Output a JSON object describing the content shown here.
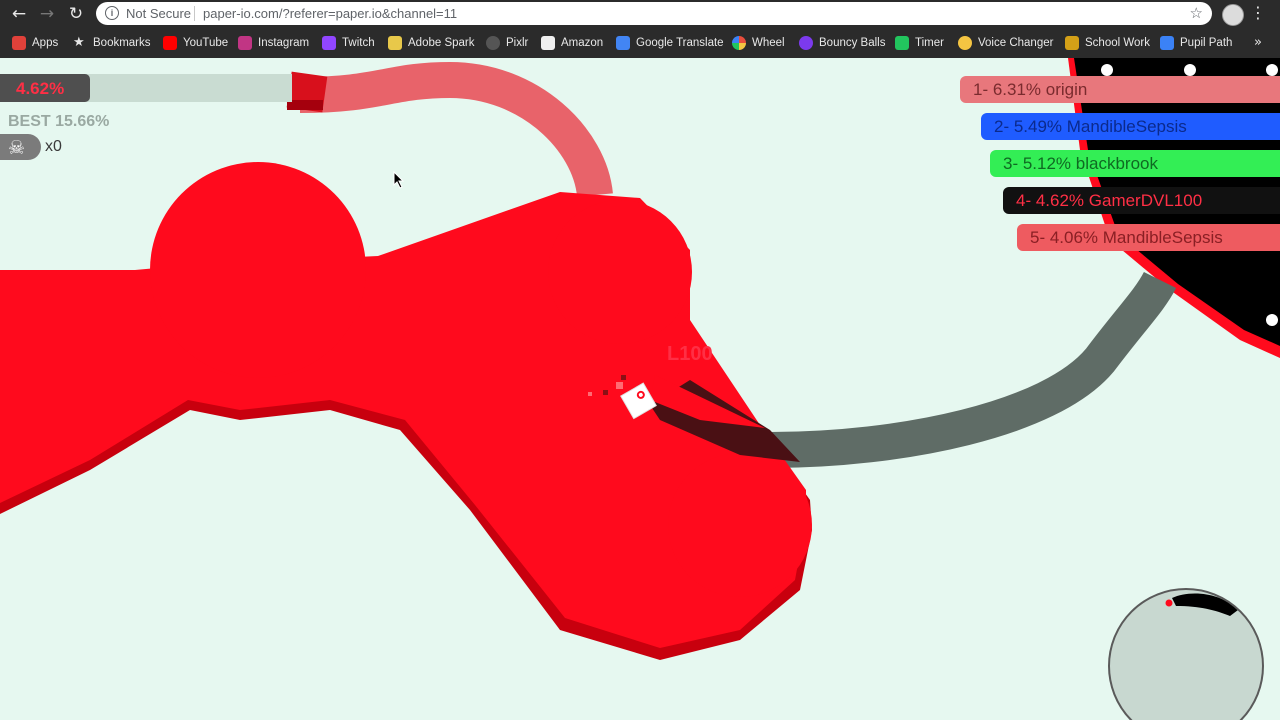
{
  "browser": {
    "security_label": "Not Secure",
    "url": "paper-io.com/?referer=paper.io&channel=11",
    "bookmarks": [
      {
        "label": "Apps",
        "icon": "apps-grid-icon",
        "color": "#e0413a"
      },
      {
        "label": "Bookmarks",
        "icon": "star-icon",
        "color": "#e8e8e8"
      },
      {
        "label": "YouTube",
        "icon": "youtube-icon",
        "color": "#ff0000"
      },
      {
        "label": "Instagram",
        "icon": "instagram-icon",
        "color": "#c13584"
      },
      {
        "label": "Twitch",
        "icon": "twitch-icon",
        "color": "#9146ff"
      },
      {
        "label": "Adobe Spark",
        "icon": "adobe-spark-icon",
        "color": "#e8c84a"
      },
      {
        "label": "Pixlr",
        "icon": "pixlr-icon",
        "color": "#555555"
      },
      {
        "label": "Amazon",
        "icon": "amazon-icon",
        "color": "#f0f0f0"
      },
      {
        "label": "Google Translate",
        "icon": "google-translate-icon",
        "color": "#4285f4"
      },
      {
        "label": "Wheel",
        "icon": "wheel-icon",
        "color": "#e94d3c"
      },
      {
        "label": "Bouncy Balls",
        "icon": "bouncy-balls-icon",
        "color": "#7c3aed"
      },
      {
        "label": "Timer",
        "icon": "timer-icon",
        "color": "#22c55e"
      },
      {
        "label": "Voice Changer",
        "icon": "voice-changer-icon",
        "color": "#f5c542"
      },
      {
        "label": "School Work",
        "icon": "school-work-icon",
        "color": "#d4a017"
      },
      {
        "label": "Pupil Path",
        "icon": "pupil-path-icon",
        "color": "#3b82f6"
      }
    ],
    "more_label": "»"
  },
  "hud": {
    "score": "4.62%",
    "best": "BEST 15.66%",
    "kills": "x0",
    "player_name_visible": "L100"
  },
  "leaderboard": [
    {
      "text": "1- 6.31% origin",
      "bg": "#e8777c",
      "fg": "#7a2b2e"
    },
    {
      "text": "2- 5.49% MandibleSepsis",
      "bg": "#1f5cff",
      "fg": "#0b2a8c"
    },
    {
      "text": "3- 5.12% blackbrook",
      "bg": "#33ee55",
      "fg": "#0f6a22"
    },
    {
      "text": "4- 4.62% GamerDVL100",
      "bg": "#111111",
      "fg": "#ff2f45"
    },
    {
      "text": "5- 4.06% MandibleSepsis",
      "bg": "#ee5b60",
      "fg": "#8a1f24"
    }
  ],
  "colors": {
    "background": "#e6f8f0",
    "player_territory": "#ff0a1d",
    "player_shadow": "#c8000e",
    "player_trail": "#e8636a",
    "enemy_trail": "#5f6c66",
    "enemy_territory": "#000000"
  }
}
